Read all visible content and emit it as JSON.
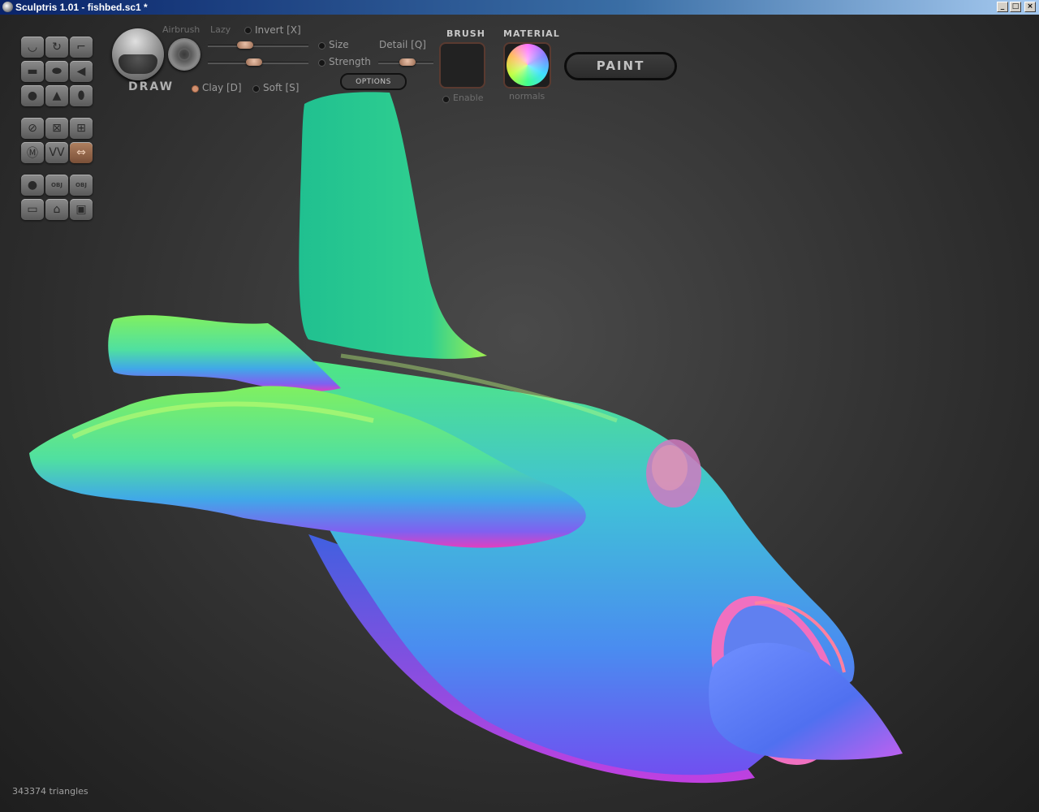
{
  "window": {
    "title": "Sculptris 1.01 - fishbed.sc1 *",
    "buttons": [
      "_",
      "□",
      "×"
    ]
  },
  "toolbar": {
    "brush_name": "DRAW",
    "airbrush_label": "Airbrush",
    "lazy_label": "Lazy",
    "invert_label": "Invert [X]",
    "size_label": "Size",
    "strength_label": "Strength",
    "detail_label": "Detail [Q]",
    "clay_label": "Clay [D]",
    "soft_label": "Soft [S]",
    "options_label": "OPTIONS",
    "brush_header": "BRUSH",
    "enable_label": "Enable",
    "material_header": "MATERIAL",
    "material_name": "normals",
    "paint_label": "PAINT",
    "sliders": {
      "size": 0.35,
      "strength": 0.45,
      "detail": 0.55
    }
  },
  "tools": {
    "sculpt": [
      "draw-icon",
      "rotate-icon",
      "crop-icon",
      "flatten-icon",
      "inflate-icon",
      "pinch-icon",
      "grab-icon",
      "smooth-icon",
      "crease-icon"
    ],
    "mesh": [
      "symmetry-icon",
      "mask-off-icon",
      "grid-icon",
      "wireframe-icon",
      "reduce-icon",
      "mirror-icon"
    ],
    "file": [
      {
        "icon": "sphere-icon",
        "text": ""
      },
      {
        "icon": "import-obj-icon",
        "text": "OBJ"
      },
      {
        "icon": "export-obj-icon",
        "text": "OBJ"
      },
      {
        "icon": "plane-icon",
        "text": ""
      },
      {
        "icon": "open-icon",
        "text": ""
      },
      {
        "icon": "save-icon",
        "text": ""
      }
    ]
  },
  "status": {
    "triangles": "343374 triangles"
  },
  "colors": {
    "accent": "#b08060",
    "background": "#2a2a2a"
  }
}
